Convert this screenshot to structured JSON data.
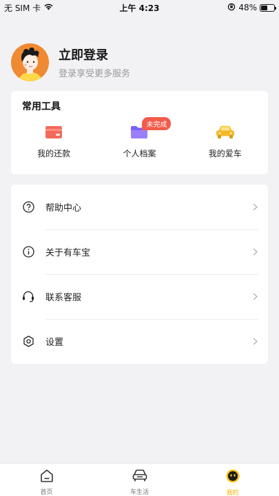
{
  "status_bar": {
    "carrier": "无 SIM 卡",
    "time": "上午 4:23",
    "battery_text": "48%",
    "battery_level": 0.48
  },
  "profile": {
    "title": "立即登录",
    "subtitle": "登录享受更多服务"
  },
  "tools": {
    "title": "常用工具",
    "items": [
      {
        "label": "我的还款",
        "icon": "card-icon"
      },
      {
        "label": "个人档案",
        "icon": "folder-icon",
        "badge": "未完成"
      },
      {
        "label": "我的爱车",
        "icon": "car-icon"
      }
    ]
  },
  "menu": {
    "items": [
      {
        "label": "帮助中心",
        "icon": "help-icon"
      },
      {
        "label": "关于有车宝",
        "icon": "info-icon"
      },
      {
        "label": "联系客服",
        "icon": "headset-icon"
      },
      {
        "label": "设置",
        "icon": "settings-icon"
      }
    ]
  },
  "tabbar": {
    "items": [
      {
        "label": "首页",
        "icon": "home-icon"
      },
      {
        "label": "车生活",
        "icon": "car-outline-icon"
      },
      {
        "label": "我的",
        "icon": "smiley-icon",
        "active": true
      }
    ]
  },
  "colors": {
    "accent": "#f0b400",
    "badge": "#f25a4b",
    "avatar_bg": "#f08a32"
  }
}
